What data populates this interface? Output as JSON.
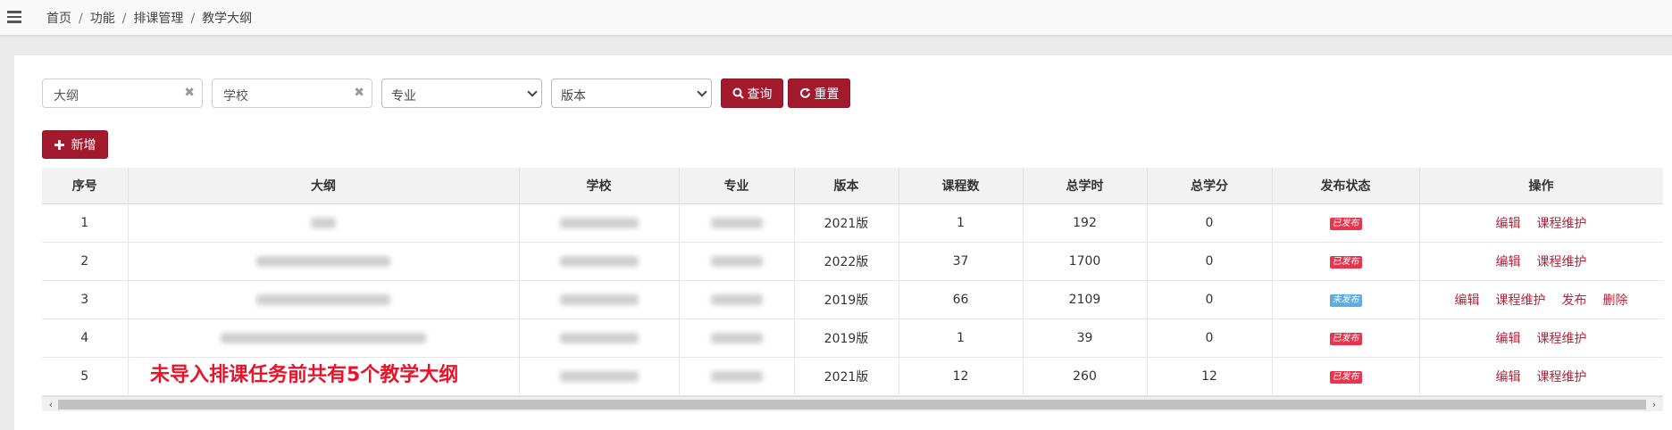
{
  "breadcrumb": [
    "首页",
    "功能",
    "排课管理",
    "教学大纲"
  ],
  "filters": {
    "outline_placeholder": "大纲",
    "school_placeholder": "学校",
    "major_selected": "专业",
    "version_selected": "版本",
    "clear_symbol": "✖"
  },
  "buttons": {
    "search": "查询",
    "reset": "重置",
    "add": "新增"
  },
  "table": {
    "headers": [
      "序号",
      "大纲",
      "学校",
      "专业",
      "版本",
      "课程数",
      "总学时",
      "总学分",
      "发布状态",
      "操作"
    ],
    "rows": [
      {
        "seq": "1",
        "version": "2021版",
        "courses": "1",
        "hours": "192",
        "credits": "0",
        "status": "已发布",
        "ops": [
          "编辑",
          "课程维护"
        ]
      },
      {
        "seq": "2",
        "version": "2022版",
        "courses": "37",
        "hours": "1700",
        "credits": "0",
        "status": "已发布",
        "ops": [
          "编辑",
          "课程维护"
        ]
      },
      {
        "seq": "3",
        "version": "2019版",
        "courses": "66",
        "hours": "2109",
        "credits": "0",
        "status": "未发布",
        "ops": [
          "编辑",
          "课程维护",
          "发布",
          "删除"
        ]
      },
      {
        "seq": "4",
        "version": "2019版",
        "courses": "1",
        "hours": "39",
        "credits": "0",
        "status": "已发布",
        "ops": [
          "编辑",
          "课程维护"
        ]
      },
      {
        "seq": "5",
        "version": "2021版",
        "courses": "12",
        "hours": "260",
        "credits": "12",
        "status": "已发布",
        "ops": [
          "编辑",
          "课程维护"
        ]
      }
    ]
  },
  "annotation": "未导入排课任务前共有5个教学大纲",
  "colors": {
    "primary": "#a3192d",
    "published": "#e8344d",
    "unpublished": "#5aaee3",
    "link": "#b4243a"
  },
  "icons": {
    "menu": "hamburger-icon",
    "search": "search-icon",
    "reset": "refresh-icon",
    "add": "plus-icon"
  }
}
